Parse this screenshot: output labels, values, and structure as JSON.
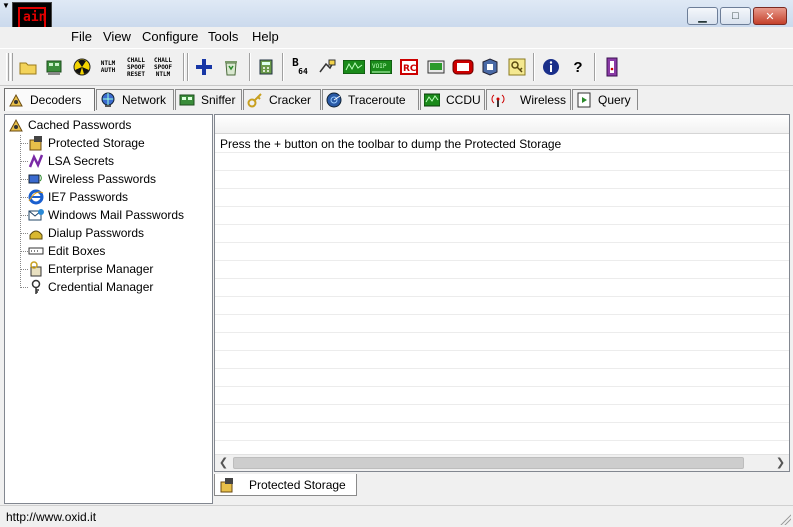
{
  "app": {
    "logo_text": "ain",
    "window_controls": {
      "minimize": "▁",
      "maximize": "□",
      "close": "✕"
    }
  },
  "menu": [
    "File",
    "View",
    "Configure",
    "Tools",
    "Help"
  ],
  "toolbar": {
    "ntlm_auth": [
      "NTLM",
      "AUTH"
    ],
    "chall_spoof_reset": [
      "CHALL",
      "SPOOF",
      "RESET"
    ],
    "chall_spoof_ntlm": [
      "CHALL",
      "SPOOF",
      "NTLM"
    ],
    "base64": [
      "B",
      "64"
    ]
  },
  "tabs": [
    {
      "label": "Decoders",
      "icon": "decoder-icon",
      "active": true
    },
    {
      "label": "Network",
      "icon": "globe-icon"
    },
    {
      "label": "Sniffer",
      "icon": "network-card-icon"
    },
    {
      "label": "Cracker",
      "icon": "key-icon"
    },
    {
      "label": "Traceroute",
      "icon": "radar-icon"
    },
    {
      "label": "CCDU",
      "icon": "ccdu-icon"
    },
    {
      "label": "Wireless",
      "icon": "antenna-icon"
    },
    {
      "label": "Query",
      "icon": "query-icon"
    }
  ],
  "tree": {
    "root": "Cached Passwords",
    "items": [
      {
        "label": "Protected Storage",
        "icon": "protected-storage-icon"
      },
      {
        "label": "LSA Secrets",
        "icon": "lsa-secrets-icon"
      },
      {
        "label": "Wireless Passwords",
        "icon": "wireless-icon"
      },
      {
        "label": "IE7 Passwords",
        "icon": "ie-icon"
      },
      {
        "label": "Windows Mail Passwords",
        "icon": "mail-icon"
      },
      {
        "label": "Dialup Passwords",
        "icon": "dialup-icon"
      },
      {
        "label": "Edit Boxes",
        "icon": "editbox-icon"
      },
      {
        "label": "Enterprise Manager",
        "icon": "enterprise-icon"
      },
      {
        "label": "Credential Manager",
        "icon": "credential-icon"
      }
    ]
  },
  "list": {
    "message": "Press the + button on the toolbar to dump the Protected Storage"
  },
  "bottom_tab": "Protected Storage",
  "status": "http://www.oxid.it"
}
